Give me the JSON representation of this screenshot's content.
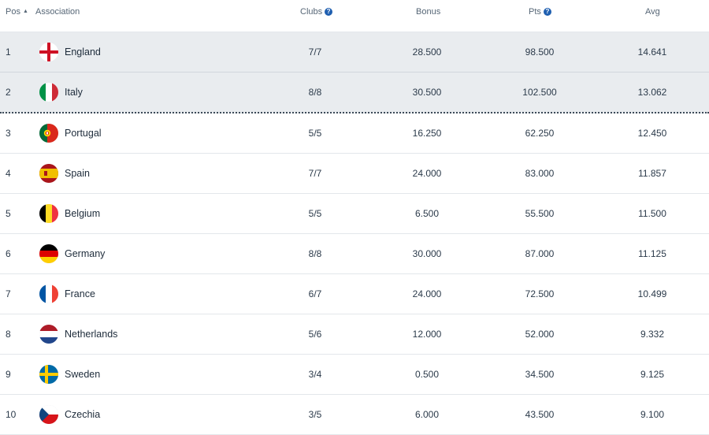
{
  "header": {
    "pos": "Pos",
    "sort_indicator": "▲",
    "association": "Association",
    "clubs": "Clubs",
    "bonus": "Bonus",
    "pts": "Pts",
    "avg": "Avg",
    "help_glyph": "?"
  },
  "rows": [
    {
      "pos": "1",
      "name": "England",
      "flag": "england-flag-icon",
      "clubs": "7/7",
      "bonus": "28.500",
      "pts": "98.500",
      "avg": "14.641"
    },
    {
      "pos": "2",
      "name": "Italy",
      "flag": "italy-flag-icon",
      "clubs": "8/8",
      "bonus": "30.500",
      "pts": "102.500",
      "avg": "13.062"
    },
    {
      "pos": "3",
      "name": "Portugal",
      "flag": "portugal-flag-icon",
      "clubs": "5/5",
      "bonus": "16.250",
      "pts": "62.250",
      "avg": "12.450"
    },
    {
      "pos": "4",
      "name": "Spain",
      "flag": "spain-flag-icon",
      "clubs": "7/7",
      "bonus": "24.000",
      "pts": "83.000",
      "avg": "11.857"
    },
    {
      "pos": "5",
      "name": "Belgium",
      "flag": "belgium-flag-icon",
      "clubs": "5/5",
      "bonus": "6.500",
      "pts": "55.500",
      "avg": "11.500"
    },
    {
      "pos": "6",
      "name": "Germany",
      "flag": "germany-flag-icon",
      "clubs": "8/8",
      "bonus": "30.000",
      "pts": "87.000",
      "avg": "11.125"
    },
    {
      "pos": "7",
      "name": "France",
      "flag": "france-flag-icon",
      "clubs": "6/7",
      "bonus": "24.000",
      "pts": "72.500",
      "avg": "10.499"
    },
    {
      "pos": "8",
      "name": "Netherlands",
      "flag": "netherlands-flag-icon",
      "clubs": "5/6",
      "bonus": "12.000",
      "pts": "52.000",
      "avg": "9.332"
    },
    {
      "pos": "9",
      "name": "Sweden",
      "flag": "sweden-flag-icon",
      "clubs": "3/4",
      "bonus": "0.500",
      "pts": "34.500",
      "avg": "9.125"
    },
    {
      "pos": "10",
      "name": "Czechia",
      "flag": "czechia-flag-icon",
      "clubs": "3/5",
      "bonus": "6.000",
      "pts": "43.500",
      "avg": "9.100"
    }
  ],
  "colors": {
    "qualified_row_bg": "#e9ecef",
    "help_icon": "#1f5fb0",
    "text": "#2b3a4a"
  }
}
